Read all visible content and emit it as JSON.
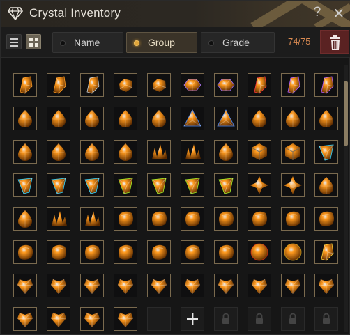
{
  "window": {
    "title": "Crystal Inventory"
  },
  "toolbar": {
    "sort_options": [
      {
        "label": "Name",
        "active": false
      },
      {
        "label": "Group",
        "active": true
      },
      {
        "label": "Grade",
        "active": false
      }
    ],
    "capacity": "74/75"
  },
  "colors": {
    "accent": "#e0a63a",
    "capacity": "#d98a52",
    "trash": "#5a2222",
    "slot_border": "#7a6a4e"
  },
  "grid": {
    "rows": [
      [
        "orange-shard",
        "orange-shard",
        "clear-shard",
        "green-cut-gem",
        "green-cut-gem",
        "purple-hex-gem",
        "purple-hex-gem",
        "red-shard",
        "violet-shard",
        "violet-shard"
      ],
      [
        "blue-drop",
        "blue-drop",
        "blue-drop",
        "blue-drop",
        "blue-drop",
        "blue-triangle",
        "blue-triangle",
        "dark-drop",
        "dark-drop",
        "dark-blue-drop"
      ],
      [
        "dark-drop",
        "dark-drop",
        "dark-drop",
        "dark-drop",
        "garnet-cluster",
        "garnet-cluster",
        "dark-drop",
        "white-cube",
        "white-cube",
        "cyan-prism"
      ],
      [
        "cyan-prism",
        "cyan-prism",
        "cyan-prism",
        "lime-prism",
        "lime-prism",
        "lime-prism",
        "lime-prism",
        "sapphire-star",
        "sapphire-star",
        "amber-drop"
      ],
      [
        "amber-drop",
        "gold-cluster",
        "gold-cluster",
        "green-stone",
        "green-stone",
        "green-stone",
        "green-stone",
        "green-stone",
        "green-stone",
        "green-stone"
      ],
      [
        "green-stone",
        "green-stone",
        "green-stone",
        "green-stone",
        "green-stone",
        "green-stone",
        "green-stone",
        "red-orb",
        "gold-orb",
        "gold-shard"
      ],
      [
        "ruby-heart",
        "ruby-heart",
        "ruby-heart",
        "ruby-heart",
        "ruby-heart",
        "ruby-heart",
        "amethyst-heart",
        "amethyst-heart",
        "amethyst-heart",
        "amethyst-heart"
      ],
      [
        "teal-heart",
        "teal-heart",
        "teal-heart",
        "teal-heart",
        "empty",
        "add",
        "locked",
        "locked",
        "locked",
        "locked"
      ]
    ],
    "icons": {
      "orange-shard": "orange-shard-icon",
      "clear-shard": "clear-shard-icon",
      "green-cut-gem": "green-gem-icon",
      "purple-hex-gem": "purple-hex-gem-icon",
      "red-shard": "red-shard-icon",
      "violet-shard": "violet-shard-icon",
      "blue-drop": "blue-drop-gem-icon",
      "blue-triangle": "blue-triangle-gem-icon",
      "dark-drop": "dark-drop-gem-icon",
      "dark-blue-drop": "dark-blue-drop-gem-icon",
      "garnet-cluster": "garnet-cluster-icon",
      "white-cube": "white-cube-gem-icon",
      "cyan-prism": "cyan-prism-icon",
      "lime-prism": "lime-prism-icon",
      "sapphire-star": "sapphire-star-icon",
      "amber-drop": "amber-drop-icon",
      "gold-cluster": "gold-cluster-icon",
      "green-stone": "green-stone-icon",
      "red-orb": "red-orb-icon",
      "gold-orb": "gold-orb-icon",
      "gold-shard": "gold-shard-icon",
      "ruby-heart": "ruby-heart-icon",
      "amethyst-heart": "amethyst-heart-icon",
      "teal-heart": "teal-heart-icon",
      "add": "plus-icon",
      "locked": "lock-icon"
    }
  }
}
